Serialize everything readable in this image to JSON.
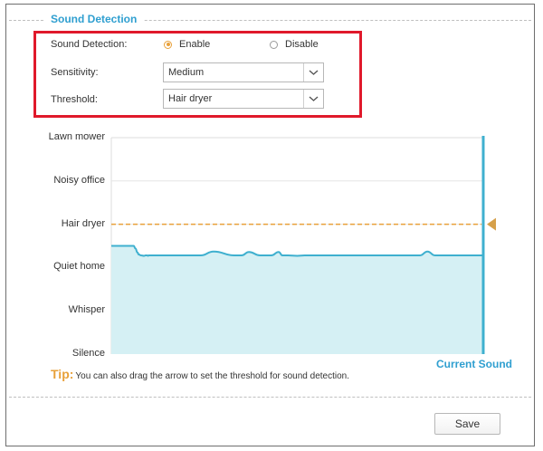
{
  "section": {
    "title": "Sound Detection"
  },
  "form": {
    "sound_detection_label": "Sound Detection:",
    "enable_label": "Enable",
    "disable_label": "Disable",
    "selected_option": "Enable",
    "sensitivity_label": "Sensitivity:",
    "sensitivity_value": "Medium",
    "threshold_label": "Threshold:",
    "threshold_value": "Hair dryer"
  },
  "chart_data": {
    "type": "area",
    "levels": [
      "Silence",
      "Whisper",
      "Quiet home",
      "Hair dryer",
      "Noisy office",
      "Lawn mower"
    ],
    "threshold_level": 3,
    "current_sound_label": "Current Sound",
    "series": [
      {
        "x": [
          0,
          0.6,
          0.65,
          0.7,
          0.74,
          0.8,
          0.88,
          0.92,
          0.96,
          0.99,
          1.0,
          1.5,
          2.2,
          2.4,
          2.75,
          3.3,
          3.5,
          3.7,
          4.0,
          4.3,
          4.5,
          4.6,
          4.75,
          5.0,
          5.2,
          5.5,
          7.5,
          8.3,
          8.5,
          8.7,
          9.0,
          9.5,
          10.0
        ],
        "y": [
          2.5,
          2.5,
          2.44,
          2.35,
          2.3,
          2.28,
          2.27,
          2.28,
          2.28,
          2.27,
          2.28,
          2.28,
          2.28,
          2.28,
          2.37,
          2.28,
          2.28,
          2.36,
          2.28,
          2.28,
          2.36,
          2.28,
          2.28,
          2.27,
          2.28,
          2.28,
          2.28,
          2.28,
          2.37,
          2.28,
          2.28,
          2.28,
          2.28
        ]
      }
    ],
    "colors": {
      "fill": "#d5f0f4",
      "line": "#3fb0cf",
      "threshold": "#e8a13a",
      "marker": "#d6a04a"
    }
  },
  "tip": {
    "prefix": "Tip:",
    "text": "You can also drag the arrow to set the threshold for sound detection."
  },
  "buttons": {
    "save_label": "Save"
  }
}
